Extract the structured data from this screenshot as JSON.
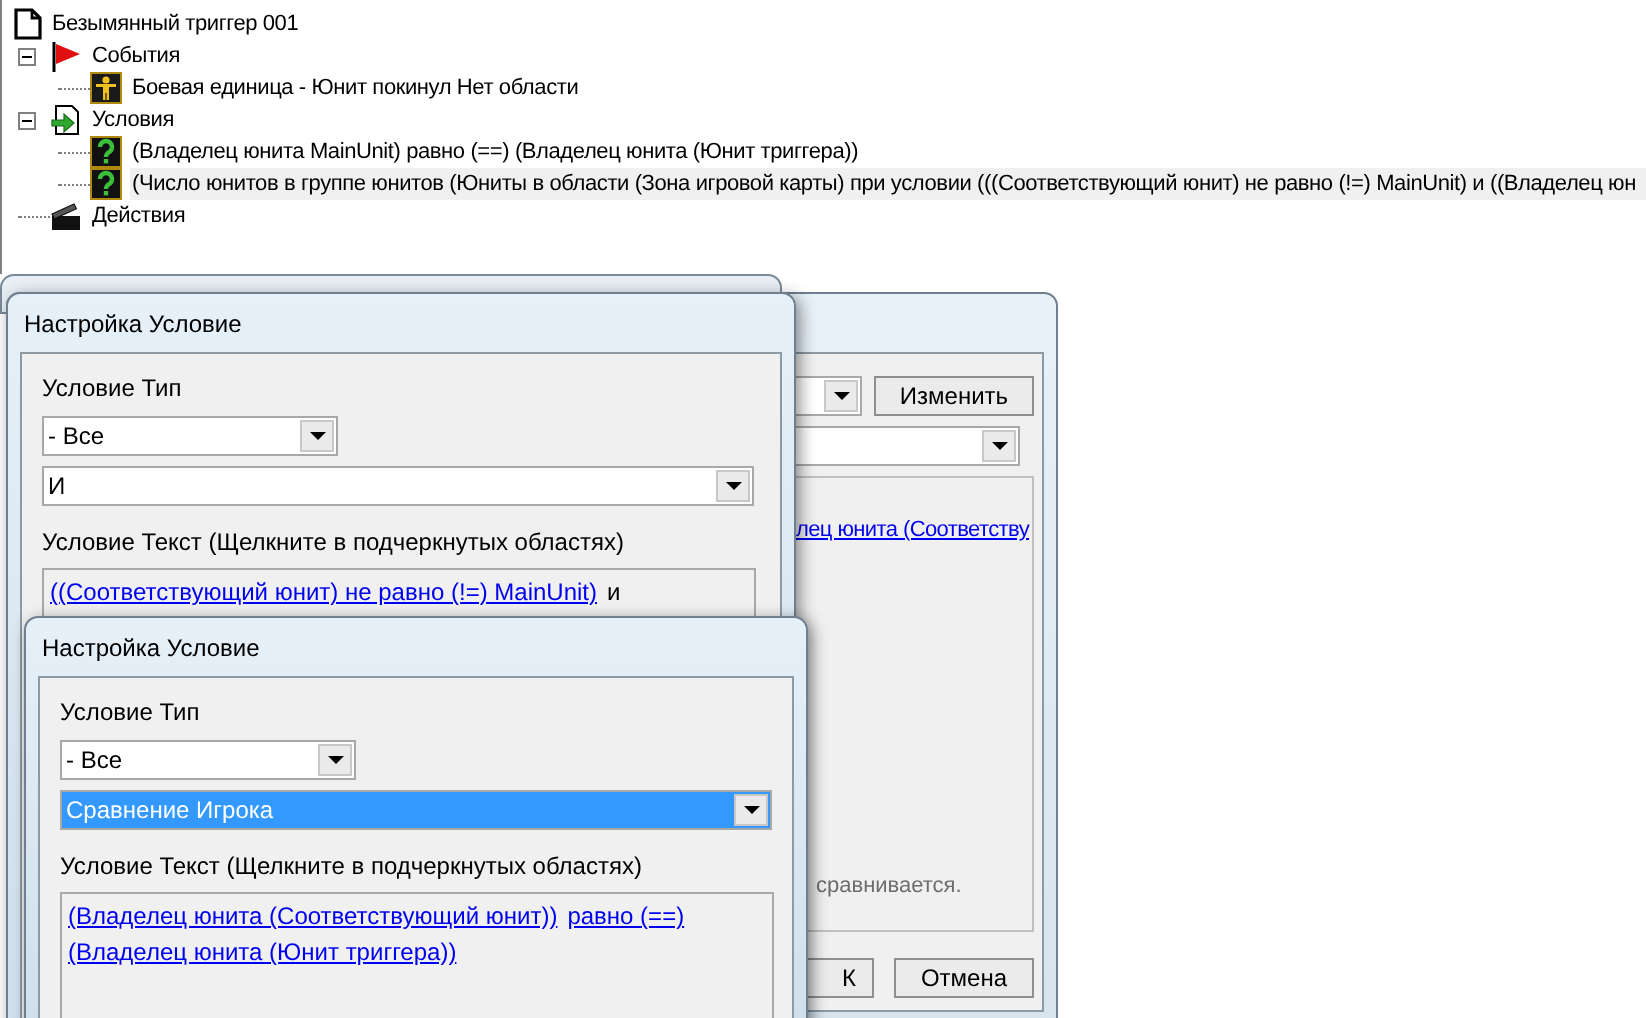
{
  "tree": {
    "label": "Безымянный триггер 001",
    "kind": "document",
    "selected": false,
    "children": [
      {
        "label": "События",
        "kind": "events",
        "expanded": true,
        "selected": false,
        "children": [
          {
            "label": "Боевая единица - Юнит покинул Нет области",
            "kind": "unit-event",
            "selected": false
          }
        ]
      },
      {
        "label": "Условия",
        "kind": "conditions",
        "expanded": true,
        "selected": false,
        "children": [
          {
            "label": "(Владелец юнита MainUnit) равно (==) (Владелец юнита (Юнит триггера))",
            "kind": "condition",
            "selected": false
          },
          {
            "label": "(Число юнитов в группе юнитов (Юниты в области (Зона игровой карты) при условии (((Соответствующий юнит) не равно (!=) MainUnit) и ((Владелец юн",
            "kind": "condition",
            "selected": true
          }
        ]
      },
      {
        "label": "Действия",
        "kind": "actions",
        "selected": false
      }
    ]
  },
  "back_dialog": {
    "edit_button": "Изменить",
    "condition_text_link": "лец юнита (Соответству",
    "description": "сравнивается.",
    "ok_button": "К",
    "cancel_button": "Отмена"
  },
  "dialogs": [
    {
      "title": "Настройка Условие",
      "type_label": "Условие Тип",
      "category": "- Все",
      "condition": {
        "value": "И",
        "selected": false
      },
      "text_label": "Условие Текст (Щелкните в подчеркнутых областях)",
      "lines": [
        [
          {
            "text": "((Соответствующий юнит) не равно (!=) MainUnit)",
            "kind": "link"
          },
          {
            "text": "и",
            "kind": "plain"
          }
        ]
      ]
    },
    {
      "title": "Настройка Условие",
      "type_label": "Условие Тип",
      "category": "- Все",
      "condition": {
        "value": "Сравнение Игрока",
        "selected": true
      },
      "text_label": "Условие Текст (Щелкните в подчеркнутых областях)",
      "lines": [
        [
          {
            "text": "(Владелец юнита (Соответствующий юнит))",
            "kind": "link"
          },
          {
            "text": "равно (==)",
            "kind": "link"
          }
        ],
        [
          {
            "text": "(Владелец юнита (Юнит триггера))",
            "kind": "link"
          }
        ]
      ]
    }
  ]
}
